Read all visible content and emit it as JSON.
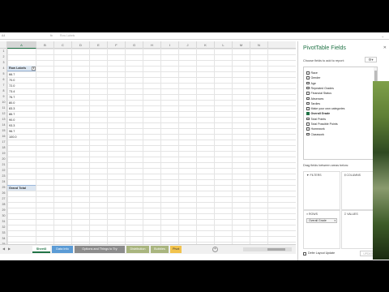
{
  "formula_bar": {
    "name_box": "A4",
    "fx": "fx",
    "formula": "Row Labels"
  },
  "grid": {
    "columns": [
      "A",
      "B",
      "C",
      "D",
      "E",
      "F",
      "G",
      "H",
      "I",
      "J",
      "K",
      "L",
      "M",
      "N"
    ],
    "active_column": "A",
    "row_numbers": [
      "1",
      "2",
      "3",
      "4",
      "5",
      "6",
      "7",
      "8",
      "9",
      "10",
      "11",
      "12",
      "13",
      "14",
      "15",
      "16",
      "17",
      "18",
      "19",
      "20",
      "21",
      "22",
      "23",
      "24",
      "25",
      "26",
      "27",
      "28",
      "29",
      "30",
      "31",
      "32",
      "33",
      "34",
      "35"
    ],
    "pivot_header": "Row Labels",
    "pivot_values": [
      "66.7",
      "70.0",
      "72.0",
      "73.4",
      "76.7",
      "80.0",
      "83.3",
      "86.7",
      "90.0",
      "93.3",
      "96.7",
      "100.0"
    ],
    "grand_total": "Grand Total"
  },
  "sheet_tabs": {
    "tabs": [
      {
        "label": "Sheet3",
        "color": "#ffffff",
        "active": true
      },
      {
        "label": "Data Info",
        "color": "#5b9bd5",
        "active": false
      },
      {
        "label": "Options and Things to Try",
        "color": "#8c8c8c",
        "active": false
      },
      {
        "label": "Distribution",
        "color": "#a9b57f",
        "active": false
      },
      {
        "label": "Bubbles",
        "color": "#a9b57f",
        "active": false
      },
      {
        "label": "Pivot",
        "color": "#f2c34d",
        "active": false
      }
    ],
    "add_icon": "+"
  },
  "pivot_panel": {
    "title": "PivotTable Fields",
    "choose_label": "Choose fields to add to report:",
    "fields": [
      {
        "label": "Race",
        "checked": false
      },
      {
        "label": "Gender",
        "checked": false
      },
      {
        "label": "Age",
        "checked": false
      },
      {
        "label": "Repeated Grades",
        "checked": false
      },
      {
        "label": "Financial Status",
        "checked": false
      },
      {
        "label": "Absences",
        "checked": false
      },
      {
        "label": "Tardies",
        "checked": false
      },
      {
        "label": "Make your own categories",
        "checked": false
      },
      {
        "label": "Overall Grade",
        "checked": true
      },
      {
        "label": "Total Points",
        "checked": false
      },
      {
        "label": "Total Possible Points",
        "checked": false
      },
      {
        "label": "Homework",
        "checked": false
      },
      {
        "label": "Classwork",
        "checked": false
      }
    ],
    "drag_label": "Drag fields between areas below:",
    "areas": {
      "filters": "FILTERS",
      "columns": "COLUMNS",
      "rows": "ROWS",
      "values": "VALUES"
    },
    "rows_chip": "Overall Grade",
    "defer_label": "Defer Layout Update",
    "update_button": "UPDATE"
  },
  "colors": {
    "accent": "#217346",
    "pivot_header_bg": "#dce6f1"
  }
}
